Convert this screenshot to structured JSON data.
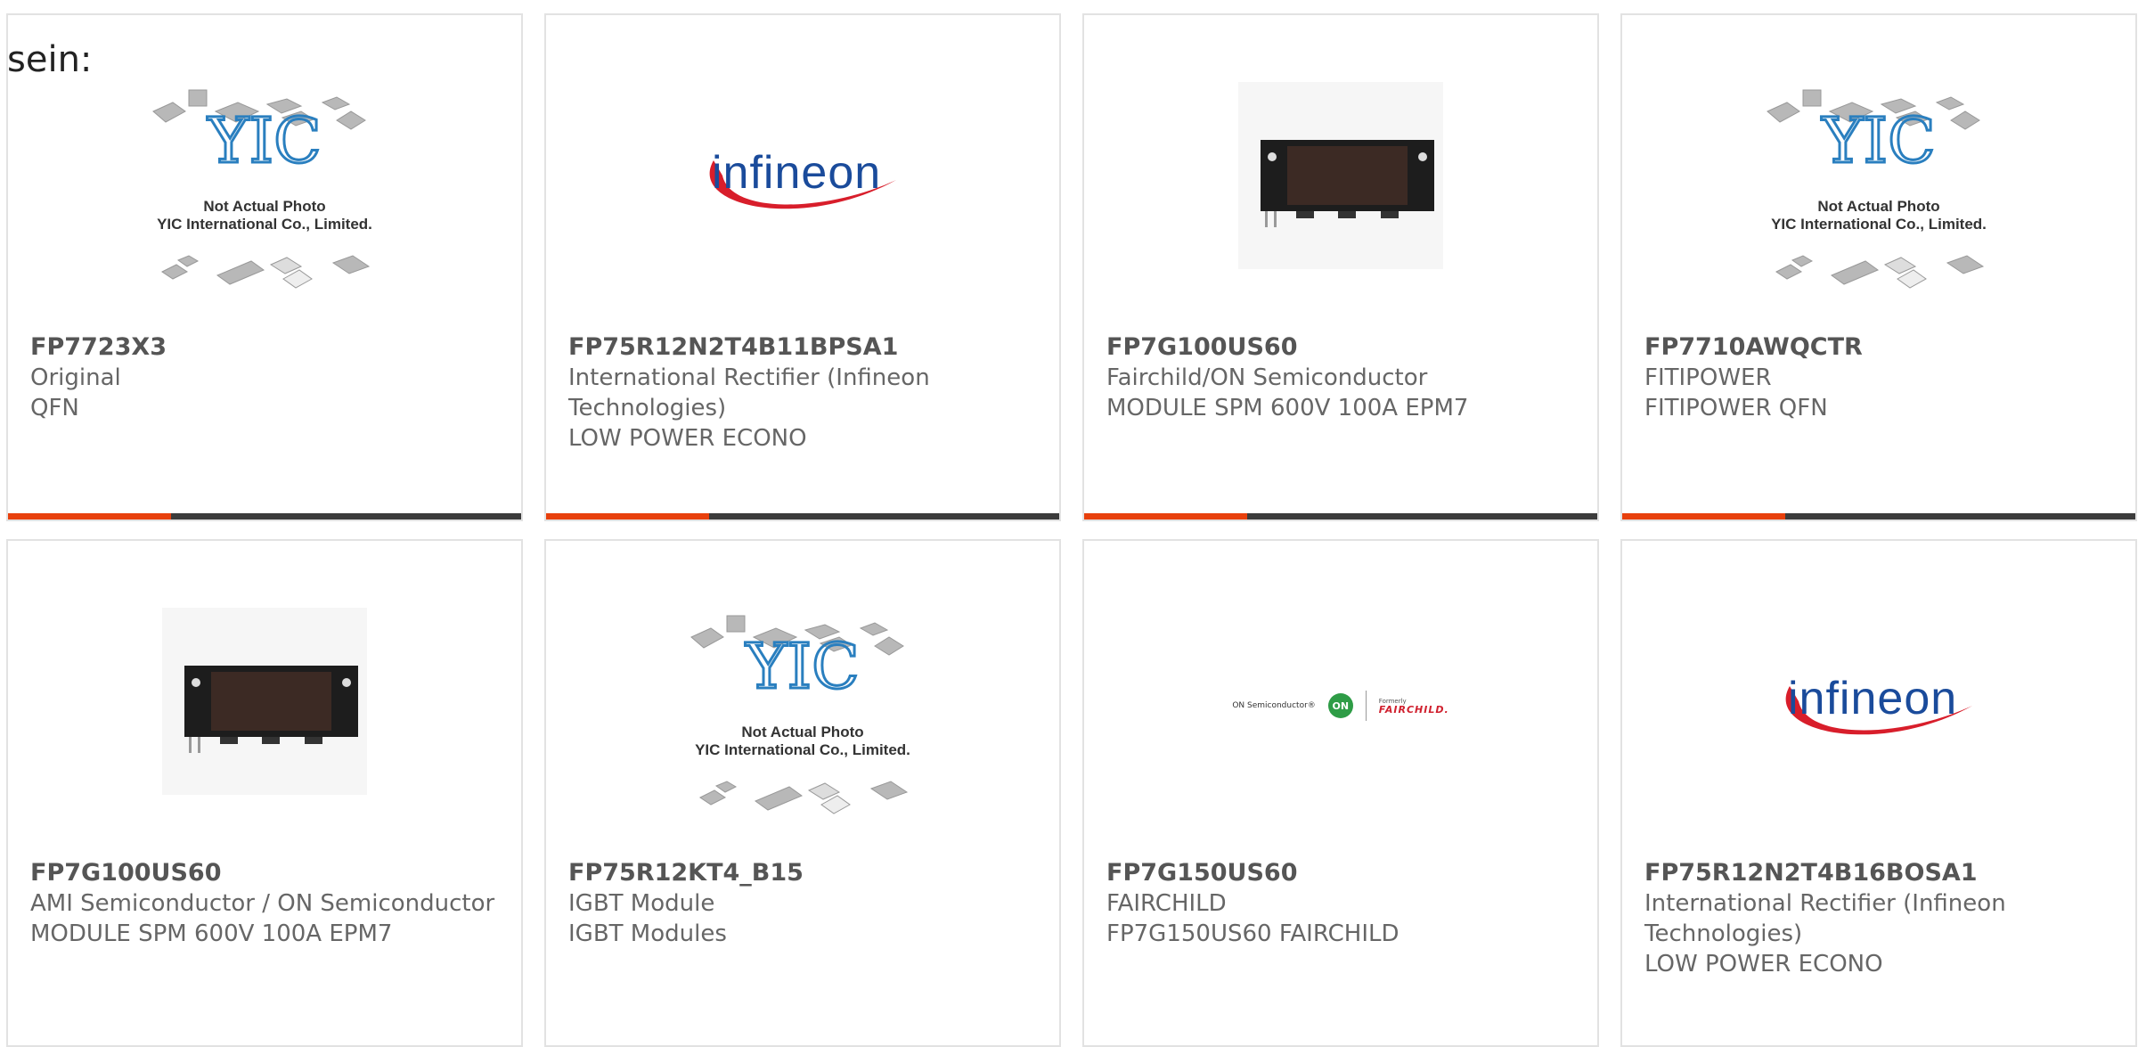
{
  "intro_text": "sein:",
  "colors": {
    "accent": "#e8400c",
    "bar": "#3c3c3c",
    "border": "#e2e2e2",
    "infineon_blue": "#1a4b9b",
    "infineon_red": "#d81e2b"
  },
  "placeholder_caption": {
    "line1": "Not Actual Photo",
    "line2": "YIC International Co., Limited.",
    "logo": "YIC"
  },
  "infineon_logo": "infineon",
  "fairchild_logo": {
    "onsemi": "ON Semiconductor®",
    "on": "ON",
    "formerly": "Formerly",
    "name": "FAIRCHILD."
  },
  "products": [
    {
      "part": "FP7723X3",
      "manufacturer": "Original",
      "description": "QFN",
      "image": "yic-placeholder"
    },
    {
      "part": "FP75R12N2T4B11BPSA1",
      "manufacturer": "International Rectifier (Infineon Technologies)",
      "description": "LOW POWER ECONO",
      "image": "infineon-logo"
    },
    {
      "part": "FP7G100US60",
      "manufacturer": "Fairchild/ON Semiconductor",
      "description": "MODULE SPM 600V 100A EPM7",
      "image": "module"
    },
    {
      "part": "FP7710AWQCTR",
      "manufacturer": "FITIPOWER",
      "description": "FITIPOWER QFN",
      "image": "yic-placeholder"
    },
    {
      "part": "FP7G100US60",
      "manufacturer": "AMI Semiconductor / ON Semiconductor",
      "description": "MODULE SPM 600V 100A EPM7",
      "image": "module"
    },
    {
      "part": "FP75R12KT4_B15",
      "manufacturer": "IGBT Module",
      "description": "IGBT Modules",
      "image": "yic-placeholder"
    },
    {
      "part": "FP7G150US60",
      "manufacturer": "FAIRCHILD",
      "description": "FP7G150US60 FAIRCHILD",
      "image": "fairchild-logo"
    },
    {
      "part": "FP75R12N2T4B16BOSA1",
      "manufacturer": "International Rectifier (Infineon Technologies)",
      "description": "LOW POWER ECONO",
      "image": "infineon-logo"
    }
  ]
}
